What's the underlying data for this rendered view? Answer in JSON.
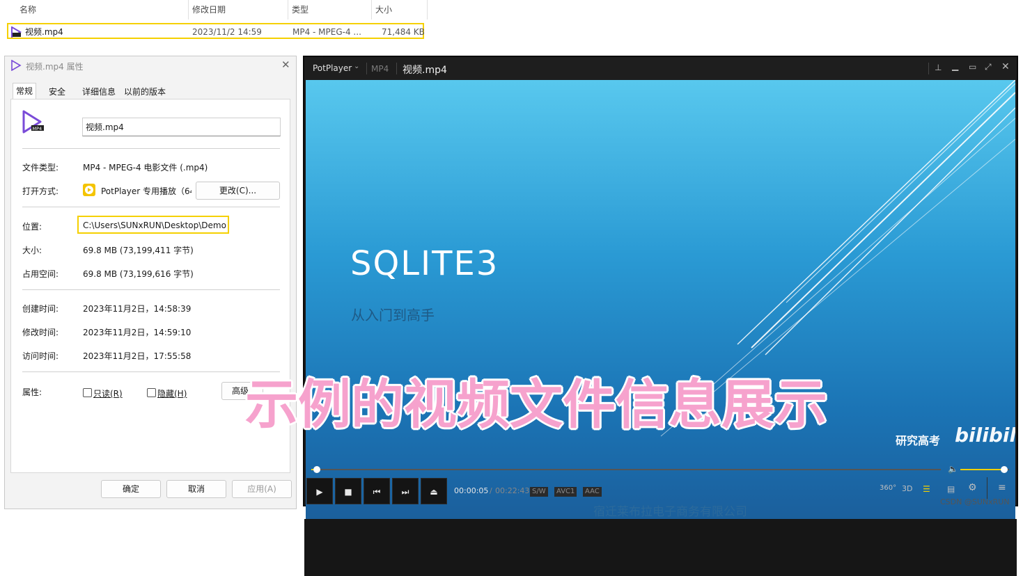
{
  "explorer": {
    "columns": [
      "名称",
      "修改日期",
      "类型",
      "大小"
    ],
    "file": {
      "name": "视频.mp4",
      "modified": "2023/11/2 14:59",
      "type": "MP4 - MPEG-4 ...",
      "size": "71,484 KB"
    }
  },
  "properties": {
    "title": "视频.mp4 属性",
    "tabs": [
      "常规",
      "安全",
      "详细信息",
      "以前的版本"
    ],
    "filename": "视频.mp4",
    "file_type_label": "文件类型:",
    "file_type": "MP4 - MPEG-4 电影文件 (.mp4)",
    "open_with_label": "打开方式:",
    "open_with": "PotPlayer 专用播放（64",
    "change_button": "更改(C)...",
    "location_label": "位置:",
    "location": "C:\\Users\\SUNxRUN\\Desktop\\Demo",
    "size_label": "大小:",
    "size": "69.8 MB (73,199,411 字节)",
    "disk_size_label": "占用空间:",
    "disk_size": "69.8 MB (73,199,616 字节)",
    "created_label": "创建时间:",
    "created": "2023年11月2日，14:58:39",
    "modified_label": "修改时间:",
    "modified": "2023年11月2日，14:59:10",
    "accessed_label": "访问时间:",
    "accessed": "2023年11月2日，17:55:58",
    "attributes_label": "属性:",
    "readonly_label": "只读(R)",
    "hidden_label": "隐藏(H)",
    "advanced_button": "高级",
    "ok_button": "确定",
    "cancel_button": "取消",
    "apply_button": "应用(A)"
  },
  "player": {
    "app_name": "PotPlayer",
    "format_badge": "MP4",
    "file_title": "视频.mp4",
    "slide_title": "SQLITE3",
    "slide_subtitle": "从入门到高手",
    "watermark": "研究高考",
    "watermark_logo": "bilibili",
    "bottom_text": "宿迁莱布拉电子商务有限公司",
    "current_time": "00:00:05",
    "separator": "/",
    "total_time": "00:22:43",
    "tags": [
      "S/W",
      "AVC1",
      "AAC"
    ],
    "icon_360": "360°",
    "icon_3d": "3D",
    "progress_fraction": 0.005,
    "volume_fraction": 0.9
  },
  "overlay_caption": "示例的视频文件信息展示",
  "credit": "CSDN @SUNxRUN",
  "colors": {
    "highlight": "#f5d000",
    "caption": "#f6a2cd",
    "player_bg": "#1b1b1b",
    "video_top": "#58c8ee",
    "video_bottom": "#1b5f9c"
  }
}
